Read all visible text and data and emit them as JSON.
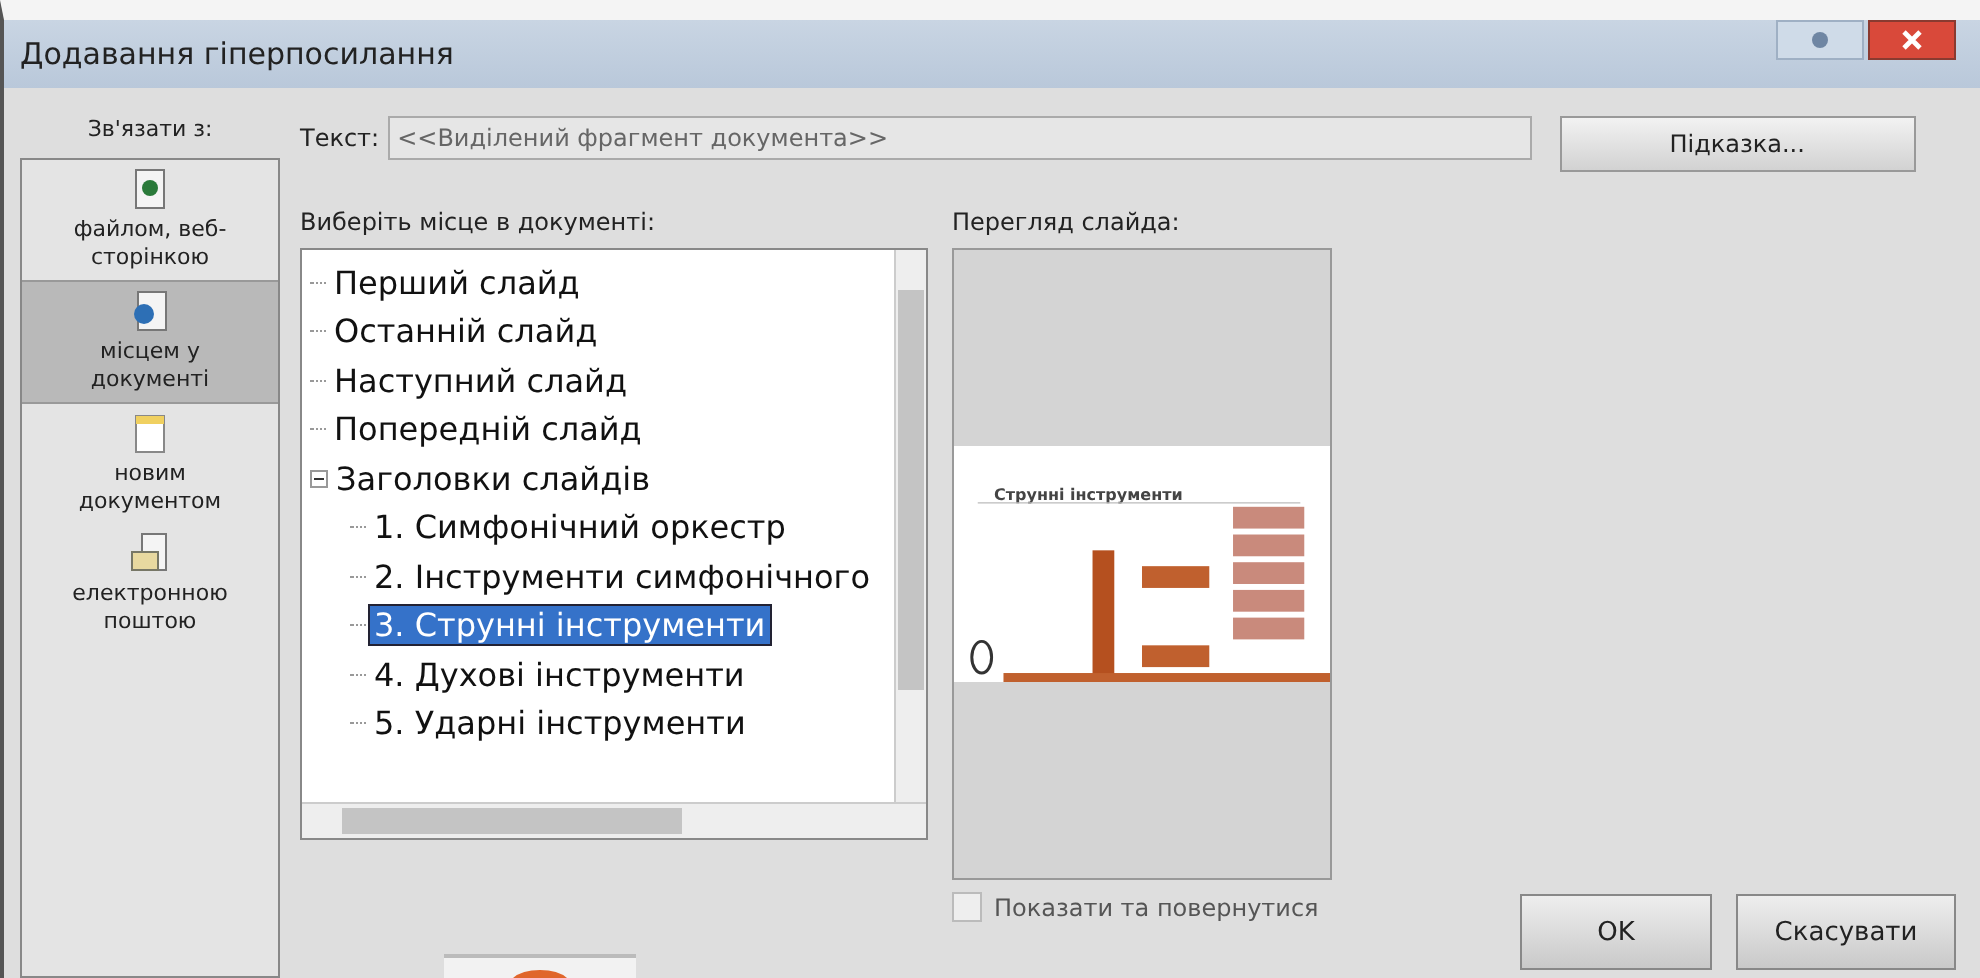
{
  "window": {
    "title": "Додавання гіперпосилання"
  },
  "sidebar": {
    "label": "Зв'язати з:",
    "items": [
      {
        "kind": "file",
        "label": "файлом, веб-сторінкою",
        "selected": false
      },
      {
        "kind": "place",
        "label": "місцем у документі",
        "selected": true
      },
      {
        "kind": "new",
        "label": "новим документом",
        "selected": false
      },
      {
        "kind": "email",
        "label": "електронною поштою",
        "selected": false
      }
    ]
  },
  "text_field": {
    "label": "Текст:",
    "value": "<<Виділений фрагмент документа>>"
  },
  "hint_button": "Підказка...",
  "tree": {
    "label": "Виберіть місце в документі:",
    "items": [
      {
        "label": "Перший слайд",
        "selected": false
      },
      {
        "label": "Останній слайд",
        "selected": false
      },
      {
        "label": "Наступний слайд",
        "selected": false
      },
      {
        "label": "Попередній слайд",
        "selected": false
      },
      {
        "label": "Заголовки слайдів",
        "selected": false,
        "expanded": true,
        "children": [
          {
            "label": "1. Симфонічний оркестр",
            "selected": false
          },
          {
            "label": "2. Інструменти симфонічного",
            "selected": false
          },
          {
            "label": "3. Струнні інструменти",
            "selected": true
          },
          {
            "label": "4. Духові інструменти",
            "selected": false
          },
          {
            "label": "5. Ударні інструменти",
            "selected": false
          }
        ]
      }
    ]
  },
  "preview": {
    "label": "Перегляд слайда:",
    "slide_title": "Струнні інструменти"
  },
  "show_and_return": {
    "label": "Показати та повернутися",
    "checked": false
  },
  "buttons": [
    "OK",
    "Скасувати"
  ]
}
